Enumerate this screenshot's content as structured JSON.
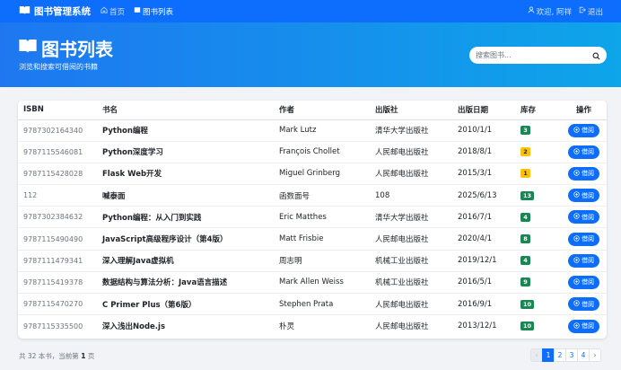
{
  "nav": {
    "brand": "图书管理系统",
    "links": [
      {
        "label": "首页",
        "icon": "house-icon",
        "active": false
      },
      {
        "label": "图书列表",
        "icon": "book-icon",
        "active": true
      }
    ],
    "welcome": "欢迎, 阿祥",
    "logout": "退出"
  },
  "hero": {
    "title": "图书列表",
    "subtitle": "浏览和搜索可借阅的书籍",
    "search_placeholder": "搜索图书..."
  },
  "table": {
    "headers": [
      "ISBN",
      "书名",
      "作者",
      "出版社",
      "出版日期",
      "库存",
      "操作"
    ],
    "borrow_label": "借阅",
    "rows": [
      {
        "isbn": "9787302164340",
        "title": "Python编程",
        "author": "Mark Lutz",
        "publisher": "清华大学出版社",
        "date": "2010/1/1",
        "stock": "3",
        "stock_color": "#198754"
      },
      {
        "isbn": "9787115546081",
        "title": "Python深度学习",
        "author": "François Chollet",
        "publisher": "人民邮电出版社",
        "date": "2018/8/1",
        "stock": "2",
        "stock_color": "#ffc107"
      },
      {
        "isbn": "9787115428028",
        "title": "Flask Web开发",
        "author": "Miguel Grinberg",
        "publisher": "人民邮电出版社",
        "date": "2015/3/1",
        "stock": "1",
        "stock_color": "#ffc107"
      },
      {
        "isbn": "112",
        "title": "喊泰面",
        "author": "函数面号",
        "publisher": "108",
        "date": "2025/6/13",
        "stock": "13",
        "stock_color": "#198754"
      },
      {
        "isbn": "9787302384632",
        "title": "Python编程：从入门到实践",
        "author": "Eric Matthes",
        "publisher": "清华大学出版社",
        "date": "2016/7/1",
        "stock": "4",
        "stock_color": "#198754"
      },
      {
        "isbn": "9787115490490",
        "title": "JavaScript高级程序设计（第4版）",
        "author": "Matt Frisbie",
        "publisher": "人民邮电出版社",
        "date": "2020/4/1",
        "stock": "8",
        "stock_color": "#198754"
      },
      {
        "isbn": "9787111479341",
        "title": "深入理解Java虚拟机",
        "author": "周志明",
        "publisher": "机械工业出版社",
        "date": "2019/12/1",
        "stock": "4",
        "stock_color": "#198754"
      },
      {
        "isbn": "9787115419378",
        "title": "数据结构与算法分析：Java语言描述",
        "author": "Mark Allen Weiss",
        "publisher": "机械工业出版社",
        "date": "2016/5/1",
        "stock": "9",
        "stock_color": "#198754"
      },
      {
        "isbn": "9787115470270",
        "title": "C Primer Plus（第6版）",
        "author": "Stephen Prata",
        "publisher": "人民邮电出版社",
        "date": "2016/9/1",
        "stock": "10",
        "stock_color": "#198754"
      },
      {
        "isbn": "9787115335500",
        "title": "深入浅出Node.js",
        "author": "朴灵",
        "publisher": "人民邮电出版社",
        "date": "2013/12/1",
        "stock": "10",
        "stock_color": "#198754"
      }
    ]
  },
  "footer": {
    "total_prefix": "共 32 本书，当前第",
    "current_page": "1",
    "total_suffix": "页"
  },
  "pagination": {
    "prev": "‹",
    "pages": [
      "1",
      "2",
      "3",
      "4"
    ],
    "next": "›"
  },
  "colors": {
    "primary": "#0d6efd",
    "success": "#198754",
    "warning": "#ffc107"
  }
}
